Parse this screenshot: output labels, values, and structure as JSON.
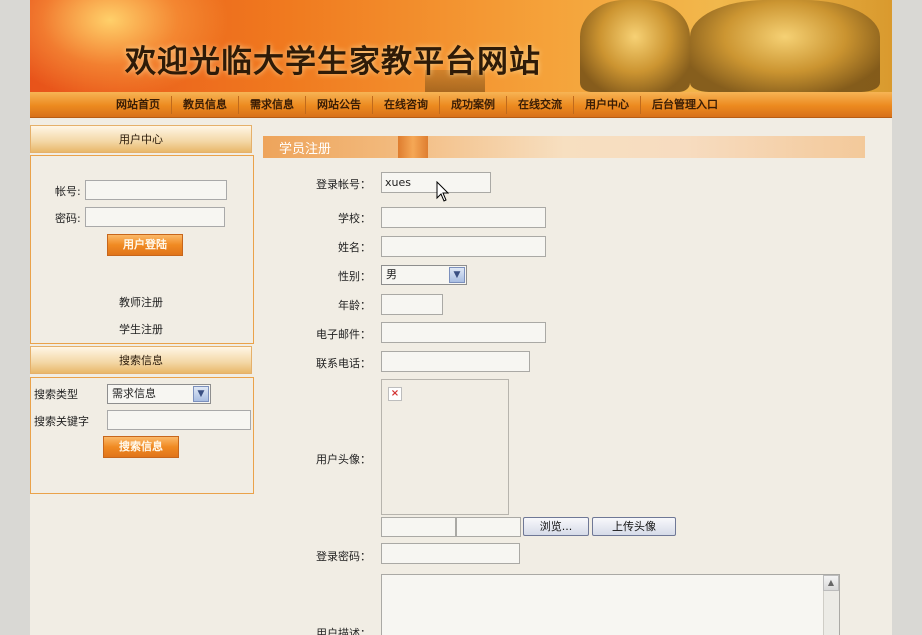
{
  "banner": {
    "title": "欢迎光临大学生家教平台网站"
  },
  "nav": {
    "items": [
      "网站首页",
      "教员信息",
      "需求信息",
      "网站公告",
      "在线咨询",
      "成功案例",
      "在线交流",
      "用户中心",
      "后台管理入口"
    ]
  },
  "sidebar": {
    "user_center": {
      "header": "用户中心",
      "account_label": "帐号:",
      "password_label": "密码:",
      "login_button": "用户登陆",
      "teacher_register": "教师注册",
      "student_register": "学生注册"
    },
    "search": {
      "header": "搜索信息",
      "type_label": "搜索类型",
      "type_selected": "需求信息",
      "keyword_label": "搜索关键字",
      "search_button": "搜索信息"
    }
  },
  "main": {
    "title": "学员注册",
    "fields": {
      "login_account": {
        "label": "登录帐号：",
        "value": "xues"
      },
      "school": {
        "label": "学校："
      },
      "name": {
        "label": "姓名："
      },
      "gender": {
        "label": "性别：",
        "selected": "男"
      },
      "age": {
        "label": "年龄："
      },
      "email": {
        "label": "电子邮件："
      },
      "phone": {
        "label": "联系电话："
      },
      "avatar": {
        "label": "用户头像：",
        "browse_button": "浏览...",
        "upload_button": "上传头像"
      },
      "password": {
        "label": "登录密码："
      },
      "description": {
        "label": "用户描述："
      }
    }
  },
  "colors": {
    "accent": "#ec8a1f",
    "banner": "#e8531a",
    "panel_border": "#eaa24a"
  },
  "icons": {
    "broken_image": "broken-image-icon",
    "cursor": "mouse-cursor-icon"
  }
}
